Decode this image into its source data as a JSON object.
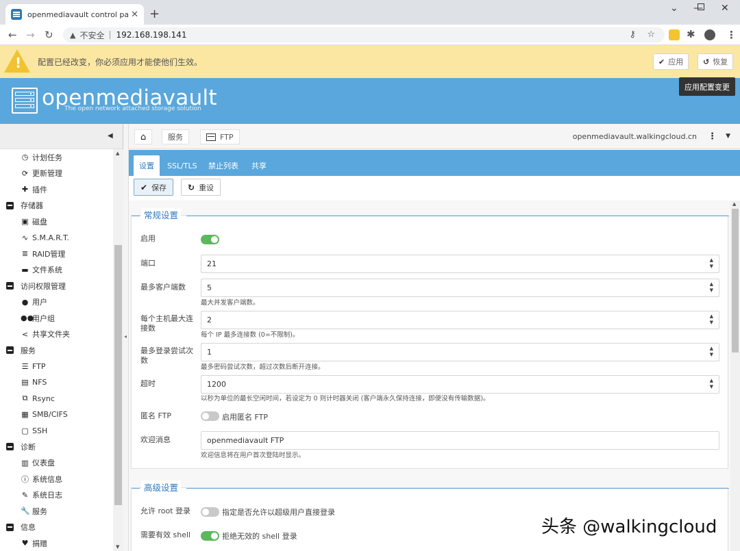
{
  "browser": {
    "tab_title": "openmediavault control panel",
    "url_insecure": "不安全",
    "url": "192.168.198.141"
  },
  "notice": {
    "message": "配置已经改变，你必须应用才能使他们生效。",
    "apply_label": "应用",
    "revert_label": "恢复",
    "tooltip": "应用配置变更"
  },
  "header": {
    "brand": "openmediavault",
    "tagline": "The open network attached storage solution"
  },
  "sidebar": {
    "items": [
      {
        "label": "计划任务",
        "type": "sub",
        "icon": "calendar-clock-icon",
        "glyph": "◷"
      },
      {
        "label": "更新管理",
        "type": "sub",
        "icon": "refresh-icon",
        "glyph": "⟳"
      },
      {
        "label": "插件",
        "type": "sub",
        "icon": "puzzle-icon",
        "glyph": "✚"
      },
      {
        "label": "存储器",
        "type": "cat",
        "icon": "minus-square-icon",
        "glyph": ""
      },
      {
        "label": "磁盘",
        "type": "sub",
        "icon": "hdd-icon",
        "glyph": "▣"
      },
      {
        "label": "S.M.A.R.T.",
        "type": "sub",
        "icon": "heartbeat-icon",
        "glyph": "∿"
      },
      {
        "label": "RAID管理",
        "type": "sub",
        "icon": "database-icon",
        "glyph": "≣"
      },
      {
        "label": "文件系统",
        "type": "sub",
        "icon": "folder-icon",
        "glyph": "▬"
      },
      {
        "label": "访问权限管理",
        "type": "cat",
        "icon": "minus-square-icon",
        "glyph": ""
      },
      {
        "label": "用户",
        "type": "sub",
        "icon": "user-icon",
        "glyph": "●"
      },
      {
        "label": "用户组",
        "type": "sub",
        "icon": "users-icon",
        "glyph": "●●"
      },
      {
        "label": "共享文件夹",
        "type": "sub",
        "icon": "share-icon",
        "glyph": "<"
      },
      {
        "label": "服务",
        "type": "cat",
        "icon": "minus-square-icon",
        "glyph": ""
      },
      {
        "label": "FTP",
        "type": "sub",
        "icon": "ftp-server-icon",
        "glyph": "☰"
      },
      {
        "label": "NFS",
        "type": "sub",
        "icon": "nfs-icon",
        "glyph": "▤"
      },
      {
        "label": "Rsync",
        "type": "sub",
        "icon": "rsync-icon",
        "glyph": "⧉"
      },
      {
        "label": "SMB/CIFS",
        "type": "sub",
        "icon": "windows-icon",
        "glyph": "▦"
      },
      {
        "label": "SSH",
        "type": "sub",
        "icon": "terminal-icon",
        "glyph": "▢"
      },
      {
        "label": "诊断",
        "type": "cat",
        "icon": "minus-square-icon",
        "glyph": ""
      },
      {
        "label": "仪表盘",
        "type": "sub",
        "icon": "dashboard-icon",
        "glyph": "▥"
      },
      {
        "label": "系统信息",
        "type": "sub",
        "icon": "info-circle-icon",
        "glyph": "ⓘ"
      },
      {
        "label": "系统日志",
        "type": "sub",
        "icon": "edit-log-icon",
        "glyph": "✎"
      },
      {
        "label": "服务",
        "type": "sub",
        "icon": "wrench-icon",
        "glyph": "🔧"
      },
      {
        "label": "信息",
        "type": "cat",
        "icon": "minus-square-icon",
        "glyph": ""
      },
      {
        "label": "捐赠",
        "type": "sub",
        "icon": "heart-icon",
        "glyph": "♥"
      }
    ]
  },
  "breadcrumb": {
    "services": "服务",
    "ftp": "FTP",
    "hostname": "openmediavault.walkingcloud.cn"
  },
  "tabs": [
    "设置",
    "SSL/TLS",
    "禁止列表",
    "共享"
  ],
  "toolbar": {
    "save_label": "保存",
    "reset_label": "重设"
  },
  "general": {
    "legend": "常规设置",
    "enable_label": "启用",
    "enable_on": true,
    "port_label": "端口",
    "port_value": "21",
    "maxclients_label": "最多客户端数",
    "maxclients_value": "5",
    "maxclients_help": "最大并发客户端数。",
    "maxconn_label": "每个主机最大连接数",
    "maxconn_value": "2",
    "maxconn_help": "每个 IP 最多连接数 (0=不限制)。",
    "maxlogin_label": "最多登录尝试次数",
    "maxlogin_value": "1",
    "maxlogin_help": "最多密码尝试次数，超过次数后断开连接。",
    "timeout_label": "超时",
    "timeout_value": "1200",
    "timeout_help": "以秒为单位的最长空闲时间，若设定为 0 则计时器关闭 (客户端永久保持连接，即便没有传输数据)。",
    "anon_label": "匿名 FTP",
    "anon_toggle_label": "启用匿名 FTP",
    "anon_on": false,
    "welcome_label": "欢迎消息",
    "welcome_value": "openmediavault FTP",
    "welcome_help": "欢迎信息将在用户首次登陆时显示。"
  },
  "advanced": {
    "legend": "高级设置",
    "root_label": "允许 root 登录",
    "root_toggle_label": "指定是否允许以超级用户直接登录",
    "root_on": false,
    "shell_label": "需要有效 shell",
    "shell_toggle_label": "拒绝无效的 shell 登录",
    "shell_on": true
  },
  "watermark": "头条 @walkingcloud"
}
